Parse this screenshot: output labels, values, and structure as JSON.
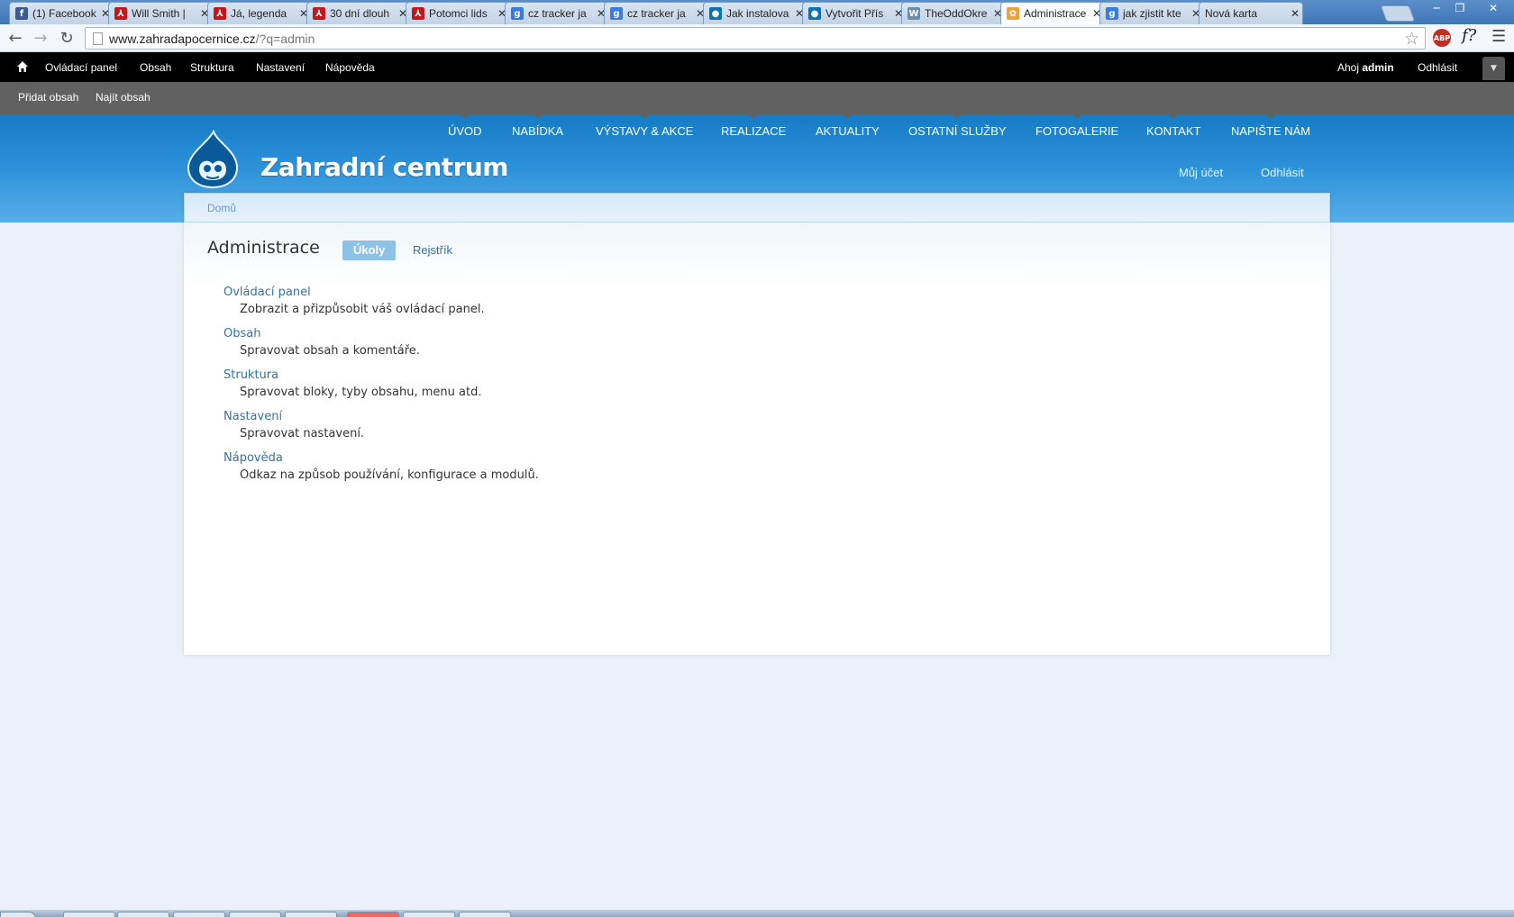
{
  "browser": {
    "tabs": [
      {
        "title": "(1) Facebook",
        "icon": "facebook-icon",
        "color": "#3b5998",
        "glyph": "f"
      },
      {
        "title": "Will Smith |",
        "icon": "adobe-reader-icon",
        "color": "#c4161c",
        "glyph": "⅄"
      },
      {
        "title": "Já, legenda",
        "icon": "adobe-reader-icon",
        "color": "#c4161c",
        "glyph": "⅄"
      },
      {
        "title": "30 dní dlouh",
        "icon": "adobe-reader-icon",
        "color": "#c4161c",
        "glyph": "⅄"
      },
      {
        "title": "Potomci lids",
        "icon": "adobe-reader-icon",
        "color": "#c4161c",
        "glyph": "⅄"
      },
      {
        "title": "cz tracker ja",
        "icon": "google-icon",
        "color": "#3b7be0",
        "glyph": "g"
      },
      {
        "title": "cz tracker ja",
        "icon": "google-icon",
        "color": "#3b7be0",
        "glyph": "g"
      },
      {
        "title": "Jak instalova",
        "icon": "drupal-icon",
        "color": "#0a71b7",
        "glyph": "●"
      },
      {
        "title": "Vytvořit Přís",
        "icon": "drupal-icon",
        "color": "#0a71b7",
        "glyph": "●"
      },
      {
        "title": "TheOddOkre",
        "icon": "wordpress-icon",
        "color": "#6a8cad",
        "glyph": "W"
      },
      {
        "title": "Administrace",
        "icon": "site-favicon-icon",
        "color": "#e8a33b",
        "glyph": "✿"
      },
      {
        "title": "jak zjistit kte",
        "icon": "google-icon",
        "color": "#3b7be0",
        "glyph": "g"
      },
      {
        "title": "Nová karta",
        "icon": "",
        "color": "",
        "glyph": ""
      }
    ],
    "active_tab": 10,
    "url_host": "www.zahradapocernice.cz",
    "url_rest": "/?q=admin",
    "abp_label": "ABP",
    "fq_label": "f?"
  },
  "toolbar": {
    "items": [
      "Ovládací panel",
      "Obsah",
      "Struktura",
      "Nastavení",
      "Nápověda"
    ],
    "greeting": "Ahoj",
    "user": "admin",
    "logout": "Odhlásit"
  },
  "shortcuts": [
    "Přidat obsah",
    "Najít obsah"
  ],
  "site": {
    "name": "Zahradní centrum",
    "main_menu": [
      "ÚVOD",
      "NABÍDKA",
      "VÝSTAVY & AKCE",
      "REALIZACE",
      "AKTUALITY",
      "OSTATNÍ SLUŽBY",
      "FOTOGALERIE",
      "KONTAKT",
      "NAPIŠTE NÁM"
    ],
    "secondary_menu": [
      "Můj účet",
      "Odhlásit"
    ],
    "accent": "#2a8fd8"
  },
  "page": {
    "breadcrumb": "Domů",
    "title": "Administrace",
    "tabs": [
      "Úkoly",
      "Rejstřík"
    ],
    "items": [
      {
        "label": "Ovládací panel",
        "desc": "Zobrazit a přizpůsobit váš ovládací panel."
      },
      {
        "label": "Obsah",
        "desc": "Spravovat obsah a komentáře."
      },
      {
        "label": "Struktura",
        "desc": "Spravovat bloky, tyby obsahu, menu atd."
      },
      {
        "label": "Nastavení",
        "desc": "Spravovat nastavení."
      },
      {
        "label": "Nápověda",
        "desc": "Odkaz na způsob používání, konfigurace a modulů."
      }
    ]
  }
}
